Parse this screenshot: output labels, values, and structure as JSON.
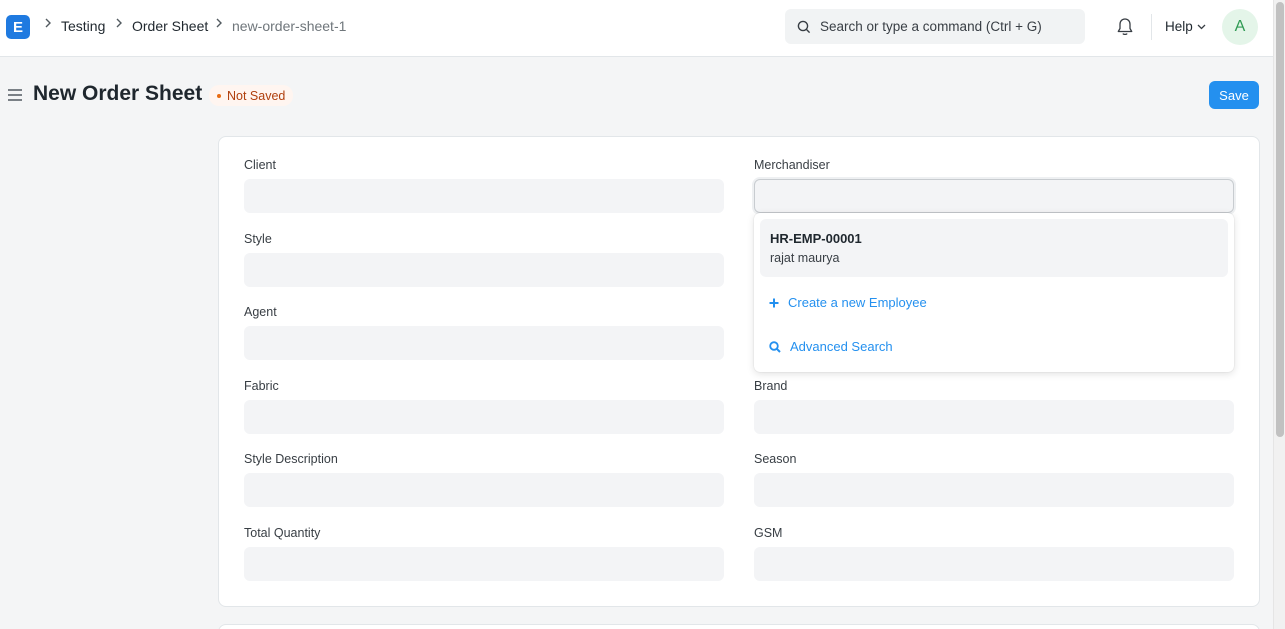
{
  "navbar": {
    "logo_letter": "E",
    "breadcrumbs": [
      "Testing",
      "Order Sheet",
      "new-order-sheet-1"
    ],
    "search_placeholder": "Search or type a command (Ctrl + G)",
    "help_label": "Help",
    "avatar_initial": "A"
  },
  "page": {
    "title": "New Order Sheet",
    "status": "Not Saved",
    "save_label": "Save"
  },
  "form": {
    "left": [
      "Client",
      "Style",
      "Agent",
      "Fabric",
      "Style Description",
      "Total Quantity"
    ],
    "right": [
      "Merchandiser",
      "Brand",
      "Season",
      "GSM"
    ]
  },
  "dropdown": {
    "item_code": "HR-EMP-00001",
    "item_name": "rajat maurya",
    "create_label": "Create a new Employee",
    "advanced_label": "Advanced Search"
  },
  "colors": {
    "primary": "#2490ef",
    "status_text": "#b03f0d",
    "status_bg": "#fff5f0"
  }
}
